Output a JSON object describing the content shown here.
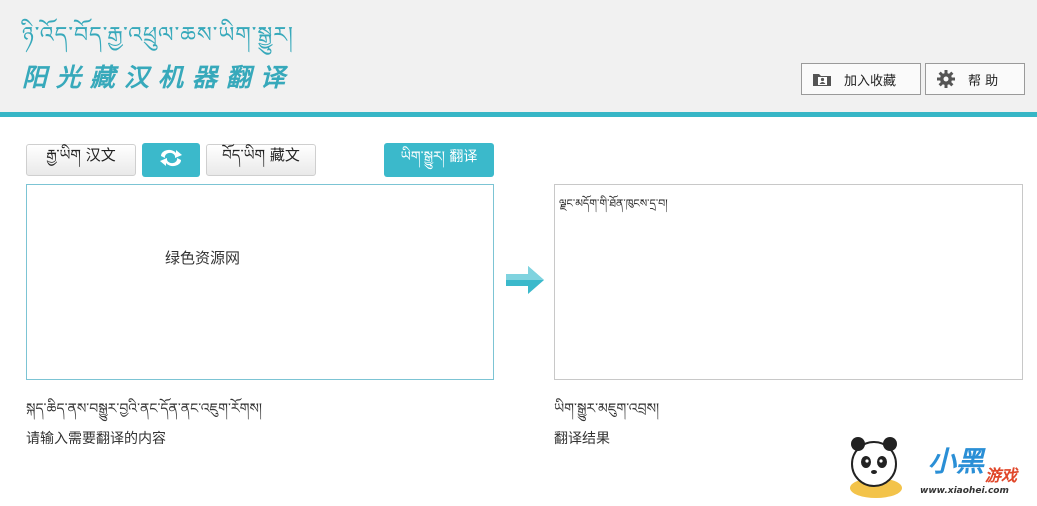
{
  "header": {
    "logo_tibetan": "ཉི་འོད་བོད་རྒྱ་འཕྲུལ་ཆས་ཡིག་སྒྱུར།",
    "logo_chinese": "阳光藏汉机器翻译",
    "favorite_label": "加入收藏",
    "help_label": "帮  助"
  },
  "toolbar": {
    "source_lang": "རྒྱ་ཡིག  汉文",
    "target_lang": "བོད་ཡིག  藏文",
    "translate_label": "ཡིག་སྒྱུར།  翻译"
  },
  "input": {
    "value": "绿色资源网",
    "caption_tibetan": "སྐད་ཆིད་ནས་བསྒྱུར་བྱའི་ནང་དོན་ནང་འཇུག་རོགས།",
    "caption_chinese": "请输入需要翻译的内容"
  },
  "output": {
    "value": "ལྗང་མདོག་གི་ཐོན་ཁུངས་དྲ་བ།",
    "caption_tibetan": "ཡིག་སྒྱུར་མཇུག་འབྲས།",
    "caption_chinese": "翻译结果"
  },
  "watermark": {
    "brand": "小黑",
    "brand_sub": "游戏",
    "url": "www.xiaohei.com"
  },
  "colors": {
    "accent": "#3bb9cb",
    "header_bg": "#f1f1f1",
    "logo": "#37a9bb"
  },
  "icons": [
    "folder-user-icon",
    "gear-icon",
    "swap-arrows-icon",
    "right-arrow-icon",
    "panda-logo-icon"
  ]
}
